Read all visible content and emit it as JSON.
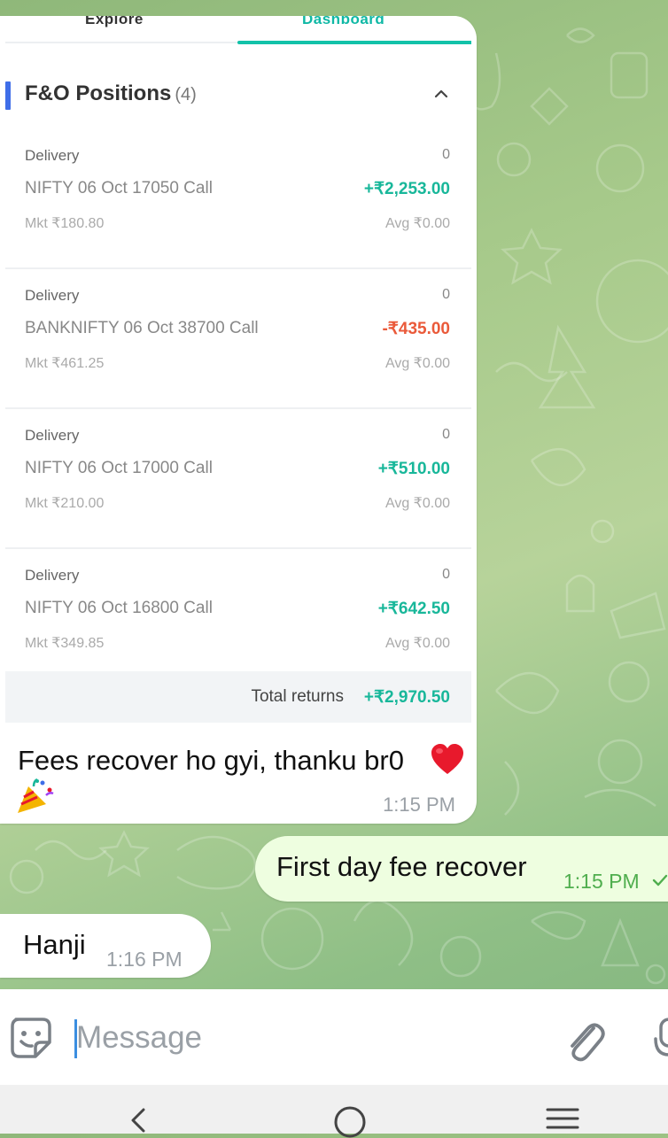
{
  "image_message": {
    "tabs": [
      {
        "label": "Explore"
      },
      {
        "label": "Dashboard",
        "active": true
      }
    ],
    "section": {
      "title": "F&O Positions",
      "count": "(4)",
      "expanded": true
    },
    "positions": [
      {
        "type": "Delivery",
        "qty": "0",
        "instrument": "NIFTY 06 Oct 17050 Call",
        "pnl": "+₹2,253.00",
        "pnl_sign": "positive",
        "mkt": "Mkt ₹180.80",
        "avg": "Avg ₹0.00"
      },
      {
        "type": "Delivery",
        "qty": "0",
        "instrument": "BANKNIFTY 06 Oct 38700 Call",
        "pnl": "-₹435.00",
        "pnl_sign": "negative",
        "mkt": "Mkt ₹461.25",
        "avg": "Avg ₹0.00"
      },
      {
        "type": "Delivery",
        "qty": "0",
        "instrument": "NIFTY 06 Oct 17000 Call",
        "pnl": "+₹510.00",
        "pnl_sign": "positive",
        "mkt": "Mkt ₹210.00",
        "avg": "Avg ₹0.00"
      },
      {
        "type": "Delivery",
        "qty": "0",
        "instrument": "NIFTY 06 Oct 16800 Call",
        "pnl": "+₹642.50",
        "pnl_sign": "positive",
        "mkt": "Mkt ₹349.85",
        "avg": "Avg ₹0.00"
      }
    ],
    "total": {
      "label": "Total returns",
      "value": "+₹2,970.50"
    },
    "caption": "Fees recover ho gyi, thanku br0",
    "caption_emojis": [
      "heart-emoji",
      "party-popper-emoji"
    ],
    "time": "1:15 PM"
  },
  "outgoing_message": {
    "text": "First day fee recover",
    "time": "1:15 PM",
    "status": "sent-check"
  },
  "incoming_message": {
    "text": "Hanji",
    "time": "1:16 PM"
  },
  "composer": {
    "placeholder": "Message"
  },
  "colors": {
    "profit": "#18b79a",
    "loss": "#ea5a3a",
    "accent_tab": "#12c2a9",
    "section_bar": "#3f6ee8",
    "outgoing_bubble": "#eefee0",
    "outgoing_time": "#4fae4e",
    "input_cursor": "#3b8ee0"
  },
  "icons": [
    "emoji-sticker-icon",
    "paperclip-icon",
    "microphone-icon",
    "chevron-up-icon",
    "back-nav-icon",
    "home-nav-icon",
    "recents-nav-icon"
  ]
}
